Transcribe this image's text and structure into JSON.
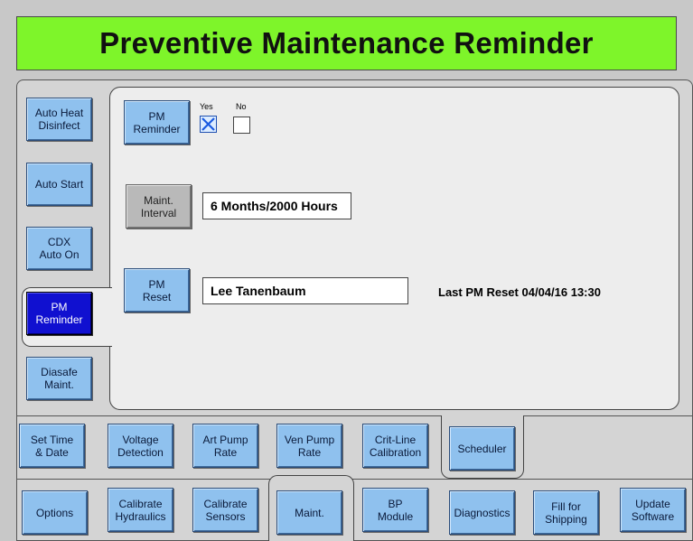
{
  "title": "Preventive Maintenance Reminder",
  "side_tabs": [
    {
      "label": "Auto Heat\nDisinfect",
      "selected": false
    },
    {
      "label": "Auto Start",
      "selected": false
    },
    {
      "label": "CDX\nAuto On",
      "selected": false
    },
    {
      "label": "PM\nReminder",
      "selected": true
    },
    {
      "label": "Diasafe\nMaint.",
      "selected": false
    }
  ],
  "pm_reminder": {
    "button_label": "PM\nReminder",
    "yes_label": "Yes",
    "no_label": "No",
    "yes_checked": true,
    "no_checked": false
  },
  "maint_interval": {
    "button_label": "Maint.\nInterval",
    "value": "6 Months/2000 Hours"
  },
  "pm_reset": {
    "button_label": "PM\nReset",
    "value": "Lee Tanenbaum",
    "last_reset_label": "Last PM Reset",
    "last_reset_value": "04/04/16 13:30"
  },
  "row1_tabs": [
    {
      "label": "Set Time\n& Date"
    },
    {
      "label": "Voltage\nDetection"
    },
    {
      "label": "Art Pump\nRate"
    },
    {
      "label": "Ven Pump\nRate"
    },
    {
      "label": "Crit-Line\nCalibration"
    },
    {
      "label": "Scheduler"
    }
  ],
  "row2_tabs": [
    {
      "label": "Options"
    },
    {
      "label": "Calibrate\nHydraulics"
    },
    {
      "label": "Calibrate\nSensors"
    },
    {
      "label": "Maint."
    },
    {
      "label": "BP\nModule"
    },
    {
      "label": "Diagnostics"
    },
    {
      "label": "Fill for\nShipping"
    },
    {
      "label": "Update\nSoftware"
    }
  ],
  "colors": {
    "title_bg": "#7ef52a",
    "button": "#8fc1ee",
    "selected_button": "#1010d0",
    "panel": "#d4d4d4",
    "content": "#ededed"
  }
}
